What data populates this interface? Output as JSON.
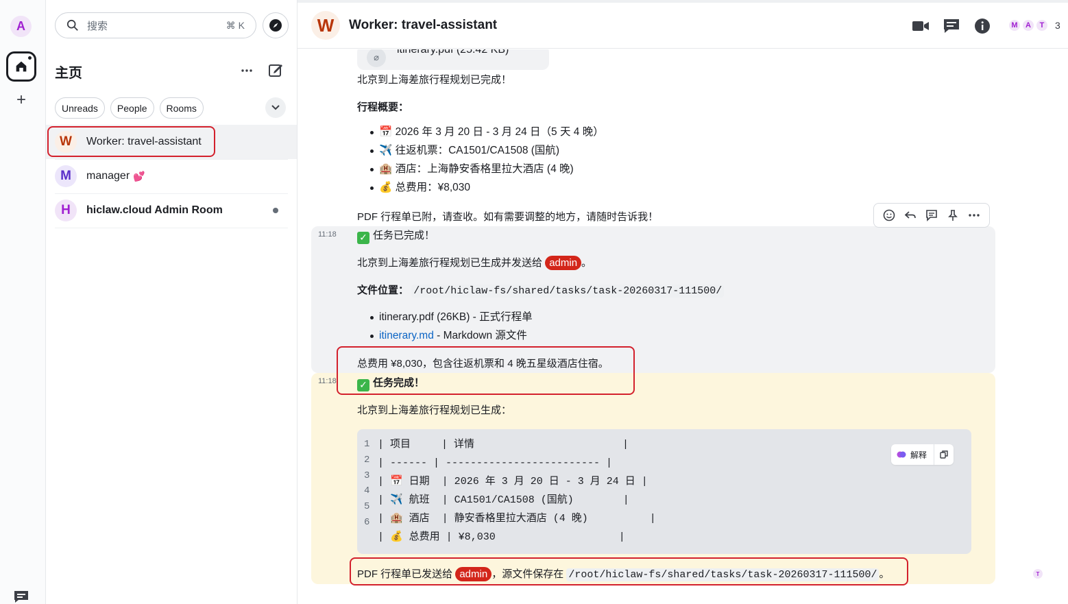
{
  "rail": {
    "user_initial": "A",
    "add_symbol": "+"
  },
  "roomlist": {
    "search_placeholder": "搜索",
    "search_shortcut": "⌘ K",
    "title": "主页",
    "filters": [
      "Unreads",
      "People",
      "Rooms"
    ],
    "rooms": [
      {
        "initial": "W",
        "name": "Worker: travel-assistant",
        "emoji": ""
      },
      {
        "initial": "M",
        "name": "manager",
        "emoji": "💕"
      },
      {
        "initial": "H",
        "name": "hiclaw.cloud Admin Room",
        "emoji": ""
      }
    ]
  },
  "header": {
    "avatar_initial": "W",
    "title": "Worker: travel-assistant",
    "facepile": [
      "M",
      "A",
      "T"
    ],
    "member_count": "3"
  },
  "timeline": {
    "attachment": "itinerary.pdf (25.42 KB)",
    "msg1_line1": "北京到上海差旅行程规划已完成！",
    "msg1_overview_heading": "行程概要：",
    "msg1_bullets": [
      "📅 2026 年 3 月 20 日 - 3 月 24 日（5 天 4 晚）",
      "✈️ 往返机票：CA1501/CA1508 (国航)",
      "🏨 酒店：上海静安香格里拉大酒店 (4 晚)",
      "💰 总费用：¥8,030"
    ],
    "msg1_footer": "PDF 行程单已附，请查收。如有需要调整的地方，请随时告诉我！",
    "msg2": {
      "time": "11:18",
      "check": "✓",
      "line1": "任务已完成！",
      "line2_before": "北京到上海差旅行程规划已生成并发送给",
      "line2_pill": "admin",
      "line2_after": "。",
      "file_label": "文件位置：",
      "file_path": "/root/hiclaw-fs/shared/tasks/task-20260317-111500/",
      "bullet1": "itinerary.pdf (26KB) - 正式行程单",
      "bullet2_link": "itinerary.md",
      "bullet2_rest": " - Markdown 源文件",
      "summary": "总费用 ¥8,030，包含往返机票和 4 晚五星级酒店住宿。"
    },
    "msg3": {
      "time": "11:18",
      "check": "✓",
      "line1": "任务完成！",
      "line2": "北京到上海差旅行程规划已生成：",
      "code_lines": [
        "| 项目     | 详情                        |",
        "| ------ | ------------------------- |",
        "| 📅 日期  | 2026 年 3 月 20 日 - 3 月 24 日 |",
        "| ✈️ 航班  | CA1501/CA1508 (国航)        |",
        "| 🏨 酒店  | 静安香格里拉大酒店 (4 晚)          |",
        "| 💰 总费用 | ¥8,030                    |"
      ],
      "line_numbers": [
        "1",
        "2",
        "3",
        "4",
        "5",
        "6"
      ],
      "explain_label": "解释",
      "footer_before": "PDF 行程单已发送给",
      "footer_pill": "admin",
      "footer_mid": "，源文件保存在",
      "footer_path": "/root/hiclaw-fs/shared/tasks/task-20260317-111500/",
      "footer_after": "。",
      "read_receipt": "T"
    }
  }
}
